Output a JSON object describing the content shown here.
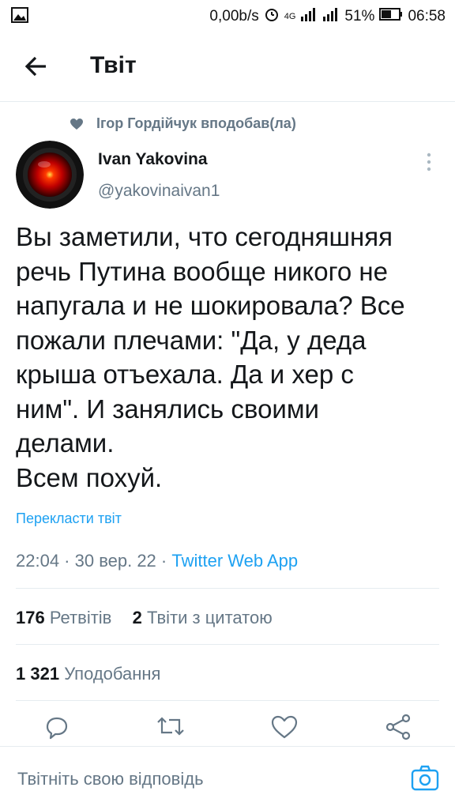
{
  "status_bar": {
    "speed": "0,00b/s",
    "battery": "51%",
    "time": "06:58",
    "network": "4G"
  },
  "header": {
    "title": "Твіт"
  },
  "social_context": {
    "text": "Ігор Гордійчук вподобав(ла)"
  },
  "author": {
    "name": "Ivan Yakovina",
    "handle": "@yakovinaivan1"
  },
  "tweet": {
    "text": "Вы заметили, что сегодняшняя\nречь Путина вообще никого не\nнапугала и не шокировала? Все\nпожали плечами: \"Да, у деда\nкрыша отъехала. Да и хер с\nним\". И занялись своими\nделами.\nВсем похуй.",
    "translate_label": "Перекласти твіт",
    "timestamp": "22:04 · 30 вер. 22 · ",
    "source": "Twitter Web App"
  },
  "stats": {
    "retweets_count": "176",
    "retweets_label": "Ретвітів",
    "quotes_count": "2",
    "quotes_label": "Твіти з цитатою",
    "likes_count": "1 321",
    "likes_label": "Уподобання"
  },
  "reply": {
    "placeholder": "Твітніть свою відповідь"
  },
  "colors": {
    "accent": "#1da1f2",
    "secondary_text": "#657786",
    "primary_text": "#14171a"
  }
}
